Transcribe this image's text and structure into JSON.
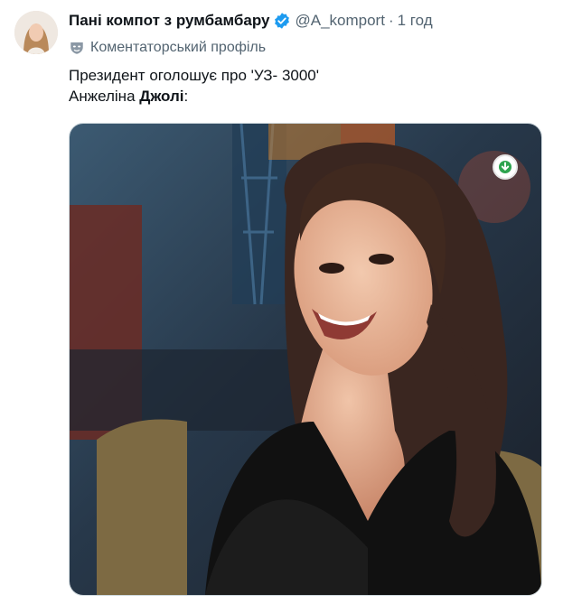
{
  "tweet": {
    "display_name": "Пані компот з румбамбару",
    "handle": "@A_komport",
    "separator": "·",
    "time": "1 год",
    "profile_label": "Коментаторський профіль",
    "line1": "Президент оголошує про 'УЗ- 3000'",
    "line2_plain": "Анжеліна ",
    "line2_bold": "Джолі",
    "line2_end": ":"
  },
  "icons": {
    "verified": "verified-badge-icon",
    "profile": "mask-icon",
    "download": "download-arrow-icon"
  },
  "colors": {
    "verified": "#1d9bf0",
    "muted": "#536471",
    "download_arrow": "#2ea44f"
  }
}
